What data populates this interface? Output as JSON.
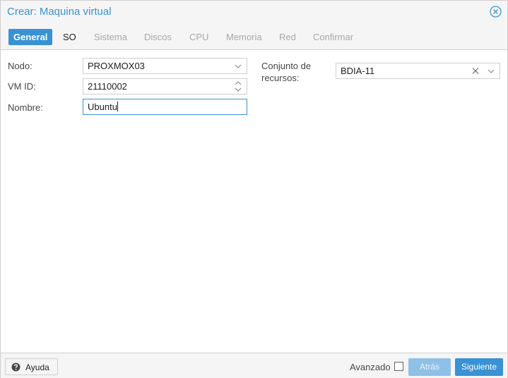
{
  "window": {
    "title": "Crear: Maquina virtual",
    "close_icon": "close-circle-icon"
  },
  "tabs": [
    {
      "label": "General",
      "state": "active"
    },
    {
      "label": "SO",
      "state": "enabled"
    },
    {
      "label": "Sistema",
      "state": "disabled"
    },
    {
      "label": "Discos",
      "state": "disabled"
    },
    {
      "label": "CPU",
      "state": "disabled"
    },
    {
      "label": "Memoria",
      "state": "disabled"
    },
    {
      "label": "Red",
      "state": "disabled"
    },
    {
      "label": "Confirmar",
      "state": "disabled"
    }
  ],
  "form": {
    "nodo": {
      "label": "Nodo:",
      "value": "PROXMOX03"
    },
    "vmid": {
      "label": "VM ID:",
      "value": "21110002"
    },
    "nombre": {
      "label": "Nombre:",
      "value": "Ubuntu"
    },
    "pool": {
      "label_line1": "Conjunto de",
      "label_line2": "recursos:",
      "value": "BDIA-11"
    }
  },
  "footer": {
    "help_label": "Ayuda",
    "advanced_label": "Avanzado",
    "advanced_checked": false,
    "back_label": "Atrás",
    "back_disabled": true,
    "next_label": "Siguiente"
  },
  "colors": {
    "accent": "#3892d4",
    "accent_disabled": "#8fc0e6",
    "border": "#cfcfcf"
  }
}
